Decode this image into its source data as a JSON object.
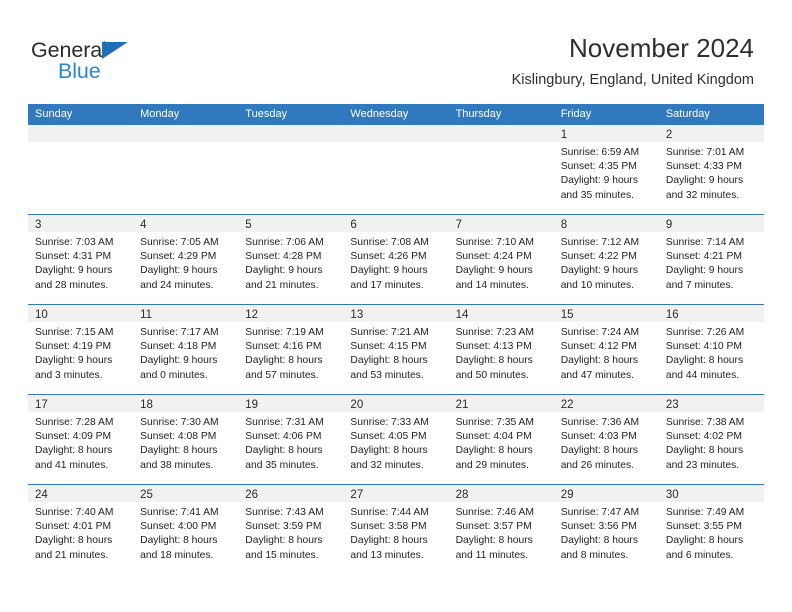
{
  "brand": {
    "name_part1": "General",
    "name_part2": "Blue",
    "triangle_icon": "triangle-icon",
    "accent_color": "#2e85d0"
  },
  "header": {
    "title": "November 2024",
    "subtitle": "Kislingbury, England, United Kingdom"
  },
  "colors": {
    "header_blue": "#3179bf",
    "date_band_gray": "#f1f1f1",
    "text": "#1f1f1f"
  },
  "weekdays": [
    "Sunday",
    "Monday",
    "Tuesday",
    "Wednesday",
    "Thursday",
    "Friday",
    "Saturday"
  ],
  "weeks": [
    [
      {
        "date": "",
        "lines": []
      },
      {
        "date": "",
        "lines": []
      },
      {
        "date": "",
        "lines": []
      },
      {
        "date": "",
        "lines": []
      },
      {
        "date": "",
        "lines": []
      },
      {
        "date": "1",
        "lines": [
          "Sunrise: 6:59 AM",
          "Sunset: 4:35 PM",
          "Daylight: 9 hours",
          "and 35 minutes."
        ]
      },
      {
        "date": "2",
        "lines": [
          "Sunrise: 7:01 AM",
          "Sunset: 4:33 PM",
          "Daylight: 9 hours",
          "and 32 minutes."
        ]
      }
    ],
    [
      {
        "date": "3",
        "lines": [
          "Sunrise: 7:03 AM",
          "Sunset: 4:31 PM",
          "Daylight: 9 hours",
          "and 28 minutes."
        ]
      },
      {
        "date": "4",
        "lines": [
          "Sunrise: 7:05 AM",
          "Sunset: 4:29 PM",
          "Daylight: 9 hours",
          "and 24 minutes."
        ]
      },
      {
        "date": "5",
        "lines": [
          "Sunrise: 7:06 AM",
          "Sunset: 4:28 PM",
          "Daylight: 9 hours",
          "and 21 minutes."
        ]
      },
      {
        "date": "6",
        "lines": [
          "Sunrise: 7:08 AM",
          "Sunset: 4:26 PM",
          "Daylight: 9 hours",
          "and 17 minutes."
        ]
      },
      {
        "date": "7",
        "lines": [
          "Sunrise: 7:10 AM",
          "Sunset: 4:24 PM",
          "Daylight: 9 hours",
          "and 14 minutes."
        ]
      },
      {
        "date": "8",
        "lines": [
          "Sunrise: 7:12 AM",
          "Sunset: 4:22 PM",
          "Daylight: 9 hours",
          "and 10 minutes."
        ]
      },
      {
        "date": "9",
        "lines": [
          "Sunrise: 7:14 AM",
          "Sunset: 4:21 PM",
          "Daylight: 9 hours",
          "and 7 minutes."
        ]
      }
    ],
    [
      {
        "date": "10",
        "lines": [
          "Sunrise: 7:15 AM",
          "Sunset: 4:19 PM",
          "Daylight: 9 hours",
          "and 3 minutes."
        ]
      },
      {
        "date": "11",
        "lines": [
          "Sunrise: 7:17 AM",
          "Sunset: 4:18 PM",
          "Daylight: 9 hours",
          "and 0 minutes."
        ]
      },
      {
        "date": "12",
        "lines": [
          "Sunrise: 7:19 AM",
          "Sunset: 4:16 PM",
          "Daylight: 8 hours",
          "and 57 minutes."
        ]
      },
      {
        "date": "13",
        "lines": [
          "Sunrise: 7:21 AM",
          "Sunset: 4:15 PM",
          "Daylight: 8 hours",
          "and 53 minutes."
        ]
      },
      {
        "date": "14",
        "lines": [
          "Sunrise: 7:23 AM",
          "Sunset: 4:13 PM",
          "Daylight: 8 hours",
          "and 50 minutes."
        ]
      },
      {
        "date": "15",
        "lines": [
          "Sunrise: 7:24 AM",
          "Sunset: 4:12 PM",
          "Daylight: 8 hours",
          "and 47 minutes."
        ]
      },
      {
        "date": "16",
        "lines": [
          "Sunrise: 7:26 AM",
          "Sunset: 4:10 PM",
          "Daylight: 8 hours",
          "and 44 minutes."
        ]
      }
    ],
    [
      {
        "date": "17",
        "lines": [
          "Sunrise: 7:28 AM",
          "Sunset: 4:09 PM",
          "Daylight: 8 hours",
          "and 41 minutes."
        ]
      },
      {
        "date": "18",
        "lines": [
          "Sunrise: 7:30 AM",
          "Sunset: 4:08 PM",
          "Daylight: 8 hours",
          "and 38 minutes."
        ]
      },
      {
        "date": "19",
        "lines": [
          "Sunrise: 7:31 AM",
          "Sunset: 4:06 PM",
          "Daylight: 8 hours",
          "and 35 minutes."
        ]
      },
      {
        "date": "20",
        "lines": [
          "Sunrise: 7:33 AM",
          "Sunset: 4:05 PM",
          "Daylight: 8 hours",
          "and 32 minutes."
        ]
      },
      {
        "date": "21",
        "lines": [
          "Sunrise: 7:35 AM",
          "Sunset: 4:04 PM",
          "Daylight: 8 hours",
          "and 29 minutes."
        ]
      },
      {
        "date": "22",
        "lines": [
          "Sunrise: 7:36 AM",
          "Sunset: 4:03 PM",
          "Daylight: 8 hours",
          "and 26 minutes."
        ]
      },
      {
        "date": "23",
        "lines": [
          "Sunrise: 7:38 AM",
          "Sunset: 4:02 PM",
          "Daylight: 8 hours",
          "and 23 minutes."
        ]
      }
    ],
    [
      {
        "date": "24",
        "lines": [
          "Sunrise: 7:40 AM",
          "Sunset: 4:01 PM",
          "Daylight: 8 hours",
          "and 21 minutes."
        ]
      },
      {
        "date": "25",
        "lines": [
          "Sunrise: 7:41 AM",
          "Sunset: 4:00 PM",
          "Daylight: 8 hours",
          "and 18 minutes."
        ]
      },
      {
        "date": "26",
        "lines": [
          "Sunrise: 7:43 AM",
          "Sunset: 3:59 PM",
          "Daylight: 8 hours",
          "and 15 minutes."
        ]
      },
      {
        "date": "27",
        "lines": [
          "Sunrise: 7:44 AM",
          "Sunset: 3:58 PM",
          "Daylight: 8 hours",
          "and 13 minutes."
        ]
      },
      {
        "date": "28",
        "lines": [
          "Sunrise: 7:46 AM",
          "Sunset: 3:57 PM",
          "Daylight: 8 hours",
          "and 11 minutes."
        ]
      },
      {
        "date": "29",
        "lines": [
          "Sunrise: 7:47 AM",
          "Sunset: 3:56 PM",
          "Daylight: 8 hours",
          "and 8 minutes."
        ]
      },
      {
        "date": "30",
        "lines": [
          "Sunrise: 7:49 AM",
          "Sunset: 3:55 PM",
          "Daylight: 8 hours",
          "and 6 minutes."
        ]
      }
    ]
  ]
}
